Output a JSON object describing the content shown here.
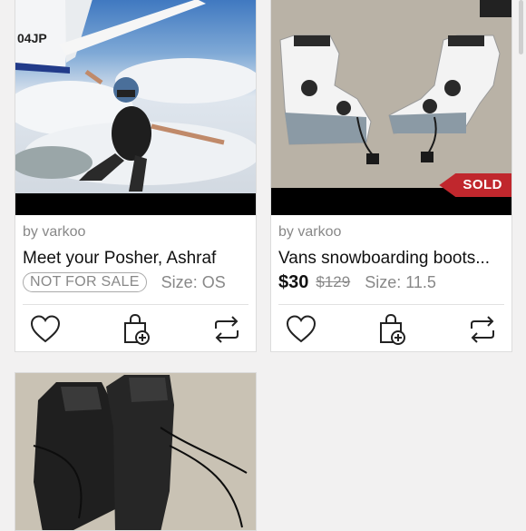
{
  "listings": [
    {
      "seller": "by varkoo",
      "title": "Meet your Posher, Ashraf",
      "badge": "NOT FOR SALE",
      "size": "Size: OS",
      "image": "skydiver-photo"
    },
    {
      "seller": "by varkoo",
      "title": "Vans snowboarding boots...",
      "price": "$30",
      "original_price": "$129",
      "size": "Size: 11.5",
      "status": "SOLD",
      "image": "white-snowboard-boots-photo"
    },
    {
      "image": "black-snowboard-boots-photo"
    }
  ],
  "aircraft_marking": "04JP",
  "icons": [
    "heart-icon",
    "bundle-bag-icon",
    "share-icon"
  ],
  "colors": {
    "sold": "#c0272d",
    "background": "#f2f1f1"
  }
}
